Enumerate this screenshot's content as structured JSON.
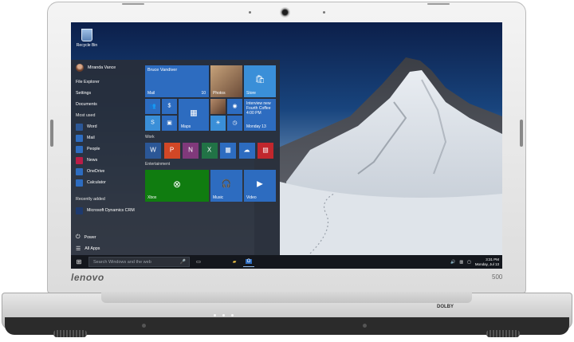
{
  "brand": "lenovo",
  "model": "500",
  "dolby": "DOLBY",
  "desktop": {
    "recycle_bin": "Recycle Bin"
  },
  "start": {
    "user": "Miranda Vance",
    "places": [
      "File Explorer",
      "Settings",
      "Documents"
    ],
    "most_used_header": "Most used",
    "most_used": [
      {
        "label": "Word",
        "color": "#2b5797"
      },
      {
        "label": "Mail",
        "color": "#2d6cc0"
      },
      {
        "label": "People",
        "color": "#2d6cc0"
      },
      {
        "label": "News",
        "color": "#b91d47"
      },
      {
        "label": "OneDrive",
        "color": "#2d6cc0"
      },
      {
        "label": "Calculator",
        "color": "#2d6cc0"
      }
    ],
    "recent_header": "Recently added",
    "recent": [
      {
        "label": "Microsoft Dynamics CRM",
        "color": "#1e3a6e"
      }
    ],
    "power": "Power",
    "all_apps": "All Apps"
  },
  "tiles": {
    "mail_from": "Bruce Vandiver",
    "mail_label": "Mail",
    "mail_count": "10",
    "photos": "Photos",
    "store": "Store",
    "maps": "Maps",
    "interview_title": "Interview new",
    "interview_place": "Fourth Coffee",
    "interview_time": "4:00 PM",
    "calendar_label": "Monday 13",
    "work": "Work",
    "entertainment": "Entertainment",
    "xbox": "Xbox",
    "music": "Music",
    "video": "Video"
  },
  "taskbar": {
    "search_placeholder": "Search Windows and the web",
    "time": "3:31 PM",
    "date": "Monday, Jul 13"
  },
  "colors": {
    "tile_blue": "#2d6cc0",
    "tile_light": "#3a8fd8",
    "xbox_green": "#107c10",
    "word": "#2b5797",
    "powerpoint": "#d24726",
    "onenote": "#80397b",
    "excel": "#217346",
    "red": "#c1272d"
  }
}
